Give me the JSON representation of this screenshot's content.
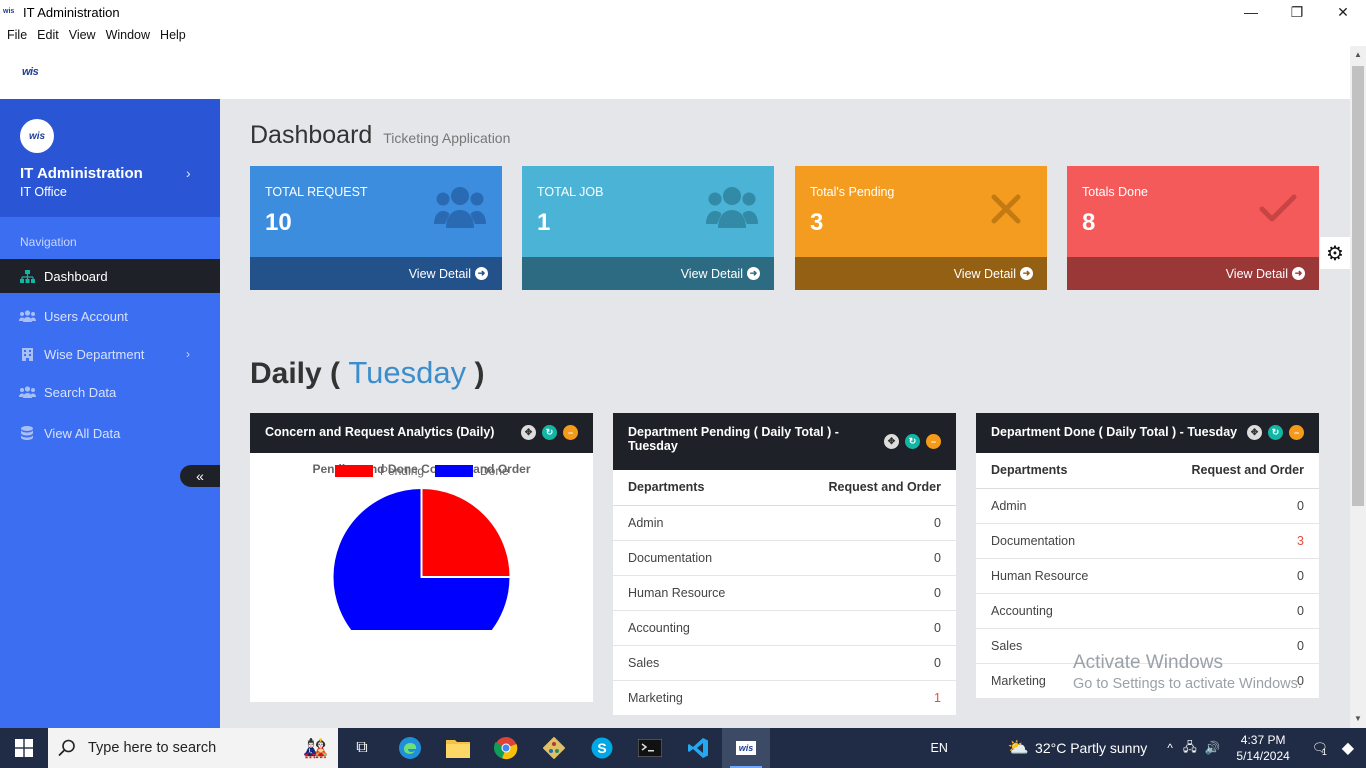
{
  "window": {
    "title": "IT Administration",
    "minimize": "—",
    "maximize": "❐",
    "close": "✕"
  },
  "menu": [
    "File",
    "Edit",
    "View",
    "Window",
    "Help"
  ],
  "logo_text": "wis",
  "sidebar": {
    "org_name": "IT Administration",
    "org_sub": "IT Office",
    "nav_title": "Navigation",
    "items": [
      {
        "label": "Dashboard",
        "icon": "sitemap-icon",
        "active": true
      },
      {
        "label": "Users Account",
        "icon": "users-icon"
      },
      {
        "label": "Wise Department",
        "icon": "building-icon",
        "has_submenu": true
      },
      {
        "label": "Search Data",
        "icon": "users-icon"
      },
      {
        "label": "View All Data",
        "icon": "database-icon"
      }
    ],
    "collapse": "«"
  },
  "header": {
    "title": "Dashboard",
    "subtitle": "Ticketing Application"
  },
  "stats": [
    {
      "label": "TOTAL REQUEST",
      "value": "10",
      "link": "View Detail",
      "color": "#3c8dde",
      "foot_color": "#23518a",
      "icon": "users-icon"
    },
    {
      "label": "TOTAL JOB",
      "value": "1",
      "link": "View Detail",
      "color": "#4bb3d6",
      "foot_color": "#2d6b82",
      "icon": "users-icon"
    },
    {
      "label": "Total's Pending",
      "value": "3",
      "link": "View Detail",
      "color": "#f39c1f",
      "foot_color": "#936014",
      "icon": "times-icon"
    },
    {
      "label": "Totals Done",
      "value": "8",
      "link": "View Detail",
      "color": "#f55a5a",
      "foot_color": "#9a3737",
      "icon": "check-icon"
    }
  ],
  "daily": {
    "prefix": "Daily (",
    "day": "Tuesday",
    "suffix": ")"
  },
  "panels": {
    "chart": {
      "title": "Concern and Request Analytics (Daily)"
    },
    "pending": {
      "title": "Department Pending ( Daily Total ) - Tuesday",
      "headers": [
        "Departments",
        "Request and Order"
      ],
      "rows": [
        [
          "Admin",
          "0"
        ],
        [
          "Documentation",
          "0"
        ],
        [
          "Human Resource",
          "0"
        ],
        [
          "Accounting",
          "0"
        ],
        [
          "Sales",
          "0"
        ],
        [
          "Marketing",
          "1"
        ]
      ]
    },
    "done": {
      "title": "Department Done ( Daily Total ) - Tuesday",
      "headers": [
        "Departments",
        "Request and Order"
      ],
      "rows": [
        [
          "Admin",
          "0"
        ],
        [
          "Documentation",
          "3"
        ],
        [
          "Human Resource",
          "0"
        ],
        [
          "Accounting",
          "0"
        ],
        [
          "Sales",
          "0"
        ],
        [
          "Marketing",
          "0"
        ]
      ]
    }
  },
  "chart_data": {
    "type": "pie",
    "title": "Pending and Done Concern and Order",
    "categories": [
      "Pending",
      "Done"
    ],
    "values": [
      3,
      9
    ],
    "colors": [
      "#ff0000",
      "#0000ff"
    ],
    "legend": "top"
  },
  "watermark": {
    "line1": "Activate Windows",
    "line2": "Go to Settings to activate Windows."
  },
  "taskbar": {
    "search_placeholder": "Type here to search",
    "language": "EN",
    "weather": "32°C  Partly sunny",
    "time": "4:37 PM",
    "date": "5/14/2024",
    "notification_count": "1"
  }
}
